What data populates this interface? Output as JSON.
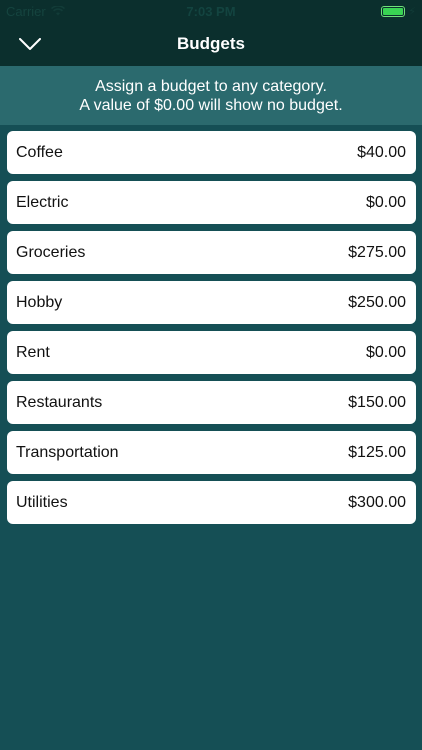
{
  "status_bar": {
    "carrier": "Carrier",
    "time": "7:03 PM",
    "battery_color": "#39d353"
  },
  "nav": {
    "title": "Budgets",
    "back_icon": "chevron-down-icon"
  },
  "info": {
    "line1": "Assign a budget to any category.",
    "line2": "A value of $0.00 will show no budget."
  },
  "budgets": [
    {
      "category": "Coffee",
      "amount": "$40.00"
    },
    {
      "category": "Electric",
      "amount": "$0.00"
    },
    {
      "category": "Groceries",
      "amount": "$275.00"
    },
    {
      "category": "Hobby",
      "amount": "$250.00"
    },
    {
      "category": "Rent",
      "amount": "$0.00"
    },
    {
      "category": "Restaurants",
      "amount": "$150.00"
    },
    {
      "category": "Transportation",
      "amount": "$125.00"
    },
    {
      "category": "Utilities",
      "amount": "$300.00"
    }
  ],
  "colors": {
    "background": "#154f55",
    "nav_background": "#0b2f2d",
    "banner_background": "#2b6a6e"
  }
}
